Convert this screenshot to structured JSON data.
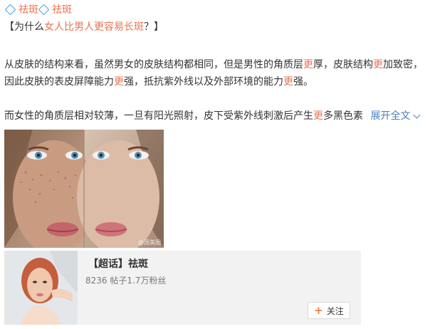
{
  "tags": [
    "祛斑",
    "祛斑"
  ],
  "title": {
    "open": "【为什么",
    "hl": "女人比男人更容易长斑",
    "close": "？】"
  },
  "para1": {
    "l1a": "从皮肤的结构来看，虽然男女的皮肤结构都相同，但是男性的角质层",
    "l1hl1": "更",
    "l1b": "厚，皮肤结构",
    "l1hl2": "更",
    "l1c": "加致密，",
    "l2a": "因此皮肤的表皮屏障能力",
    "l2hl1": "更",
    "l2b": "强，抵抗紫外线以及外部环境的能力",
    "l2hl2": "更",
    "l2c": "强。"
  },
  "para2": {
    "a": "而女性的角质层相对较薄，一旦有阳光照射，皮下受紫外线刺激后产生",
    "hl": "更",
    "b": "多黑色素",
    "expand": "展开全文"
  },
  "photo": {
    "watermark": "@国美图"
  },
  "card": {
    "title": "【超话】祛斑",
    "stats": "8236 帖子1.7万粉丝",
    "follow_label": "关注"
  }
}
